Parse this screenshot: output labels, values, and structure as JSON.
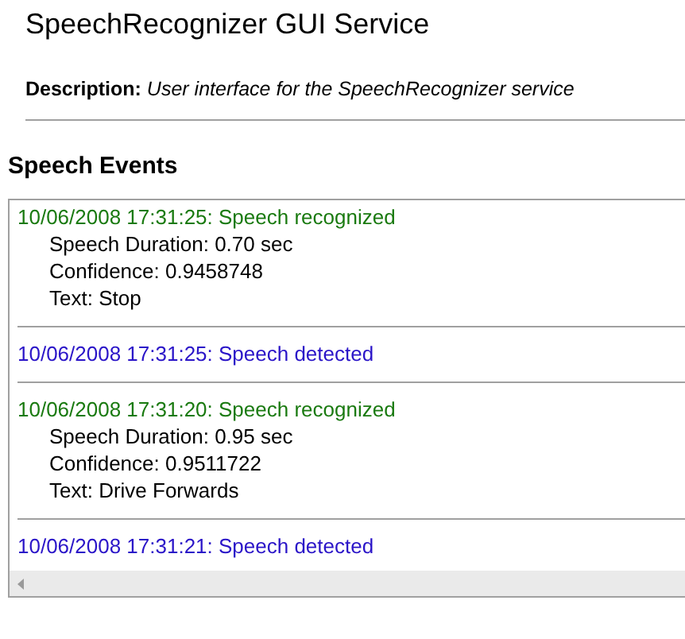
{
  "title": "SpeechRecognizer GUI Service",
  "description": {
    "label": "Description:",
    "text": "User interface for the SpeechRecognizer service"
  },
  "section_title": "Speech Events",
  "events": [
    {
      "kind": "recognized",
      "heading": "10/06/2008 17:31:25: Speech recognized",
      "details": [
        "Speech Duration: 0.70 sec",
        "Confidence: 0.9458748",
        "Text: Stop"
      ]
    },
    {
      "kind": "detected",
      "heading": "10/06/2008 17:31:25: Speech detected"
    },
    {
      "kind": "recognized",
      "heading": "10/06/2008 17:31:20: Speech recognized",
      "details": [
        "Speech Duration: 0.95 sec",
        "Confidence: 0.9511722",
        "Text: Drive Forwards"
      ]
    },
    {
      "kind": "detected",
      "heading": "10/06/2008 17:31:21: Speech detected"
    }
  ]
}
